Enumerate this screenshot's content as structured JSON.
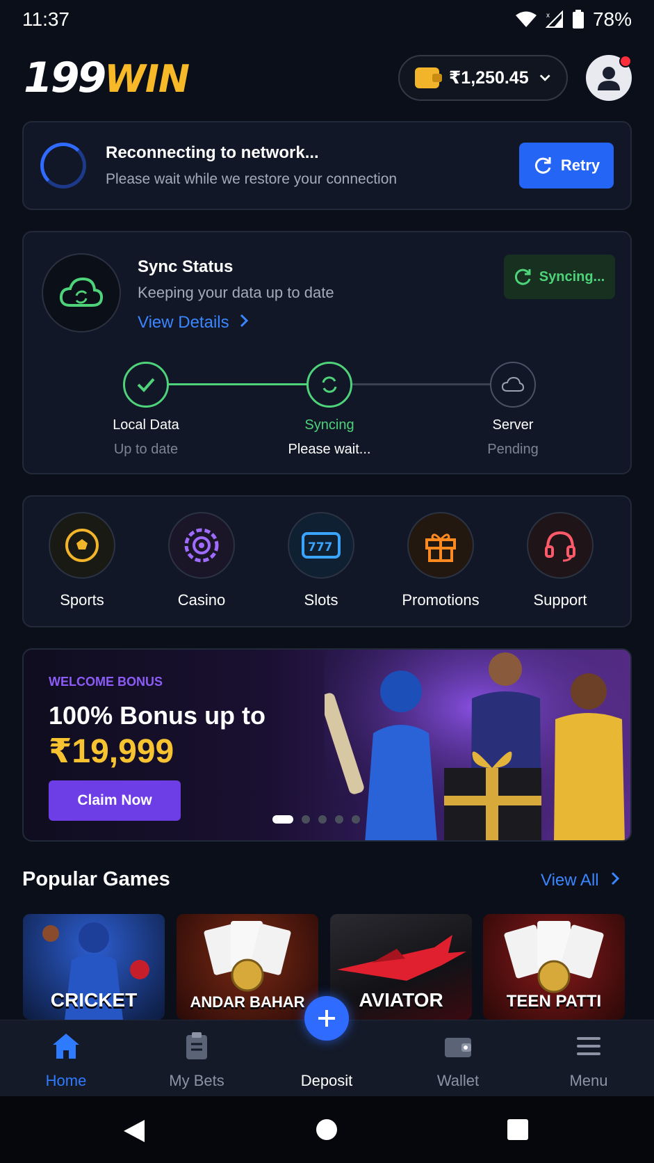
{
  "status_bar": {
    "time": "11:37",
    "battery": "78%"
  },
  "header": {
    "logo_number": "199",
    "logo_word": "WIN",
    "balance": "₹1,250.45"
  },
  "reconnect": {
    "title": "Reconnecting to network...",
    "subtitle": "Please wait while we restore your connection",
    "retry_label": "Retry"
  },
  "sync": {
    "title": "Sync Status",
    "subtitle": "Keeping your data up to date",
    "link": "View Details",
    "badge": "Syncing...",
    "steps": [
      {
        "name": "Local Data",
        "status": "Up to date"
      },
      {
        "name": "Syncing",
        "status": "Please wait..."
      },
      {
        "name": "Server",
        "status": "Pending"
      }
    ]
  },
  "quick_links": [
    {
      "label": "Sports",
      "icon": "soccer-ball-icon",
      "color": "#f2b42a"
    },
    {
      "label": "Casino",
      "icon": "casino-chip-icon",
      "color": "#a06cff"
    },
    {
      "label": "Slots",
      "icon": "slot-machine-icon",
      "color": "#3ba4ff"
    },
    {
      "label": "Promotions",
      "icon": "gift-icon",
      "color": "#ff8a1f"
    },
    {
      "label": "Support",
      "icon": "headset-icon",
      "color": "#ff5a6a"
    }
  ],
  "banner": {
    "tag": "WELCOME BONUS",
    "title": "100% Bonus up to",
    "amount": "₹19,999",
    "button": "Claim Now",
    "slide_count": 5,
    "active_slide": 1
  },
  "popular": {
    "title": "Popular Games",
    "view_all": "View All",
    "games": [
      {
        "name": "CRICKET"
      },
      {
        "name": "ANDAR BAHAR"
      },
      {
        "name": "AVIATOR"
      },
      {
        "name": "TEEN PATTI"
      }
    ]
  },
  "bottom_nav": [
    {
      "label": "Home",
      "icon": "home-icon",
      "active": true
    },
    {
      "label": "My Bets",
      "icon": "clipboard-icon",
      "active": false
    },
    {
      "label": "Deposit",
      "icon": "plus-icon",
      "active": false
    },
    {
      "label": "Wallet",
      "icon": "wallet-icon",
      "active": false
    },
    {
      "label": "Menu",
      "icon": "menu-icon",
      "active": false
    }
  ],
  "colors": {
    "background": "#0b0f1a",
    "accent_blue": "#2f6bff",
    "success_green": "#4ed37a",
    "gold": "#f7c331",
    "purple": "#6d3ee6"
  }
}
